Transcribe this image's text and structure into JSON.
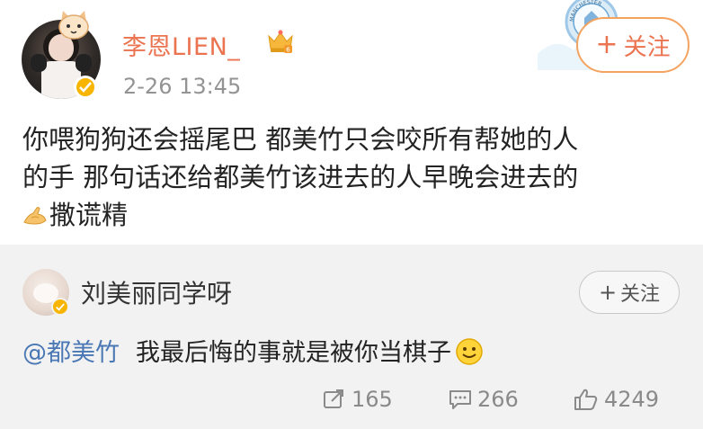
{
  "post": {
    "username": "李恩LIEN_",
    "timestamp": "2-26 13:45",
    "follow_label": "关注",
    "text_lines": [
      "你喂狗狗还会摇尾巴 都美竹只会咬所有帮她的人",
      "的手 那句话还给都美竹该进去的人早晚会进去的",
      "撒谎精"
    ],
    "icons": {
      "avatar": "user-photo",
      "crown": "crown-icon",
      "verified": "verified-badge-icon",
      "emoji": "pray-hands-icon",
      "decor": "manchester-city-badge"
    },
    "decor_text": "MANCHESTER"
  },
  "repost": {
    "username": "刘美丽同学呀",
    "follow_label": "关注",
    "mention": "@都美竹",
    "text": "我最后悔的事就是被你当棋子",
    "emoji": "smile-emoji-icon",
    "stats": {
      "repost_count": "165",
      "comment_count": "266",
      "like_count": "4249"
    }
  },
  "colors": {
    "username_orange": "#eb7350",
    "mention_blue": "#4a78b4",
    "timestamp_gray": "#939393",
    "repost_bg": "#f2f2f2",
    "verified_gold": "#f7b500"
  }
}
